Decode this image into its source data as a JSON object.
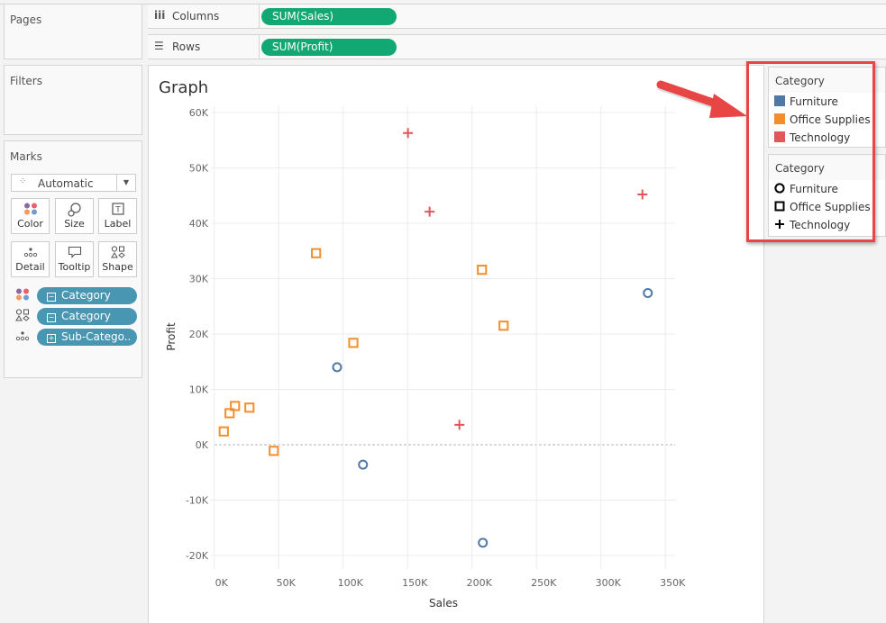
{
  "panels": {
    "pages_label": "Pages",
    "filters_label": "Filters",
    "marks_label": "Marks"
  },
  "shelves": {
    "columns": {
      "label": "Columns",
      "icon": "columns-icon",
      "pill": "SUM(Sales)"
    },
    "rows": {
      "label": "Rows",
      "icon": "rows-icon",
      "pill": "SUM(Profit)"
    }
  },
  "marks": {
    "mark_type": "Automatic",
    "buttons": [
      {
        "label": "Color",
        "icon": "color-icon"
      },
      {
        "label": "Size",
        "icon": "size-icon"
      },
      {
        "label": "Label",
        "icon": "label-icon"
      },
      {
        "label": "Detail",
        "icon": "detail-icon"
      },
      {
        "label": "Tooltip",
        "icon": "tooltip-icon"
      },
      {
        "label": "Shape",
        "icon": "shape-icon"
      }
    ],
    "fields": [
      {
        "role": "color",
        "label": "Category",
        "toggle": "−"
      },
      {
        "role": "shape",
        "label": "Category",
        "toggle": "−"
      },
      {
        "role": "detail",
        "label": "Sub-Catego..",
        "toggle": "+"
      }
    ]
  },
  "legends": {
    "color": {
      "title": "Category",
      "items": [
        {
          "label": "Furniture",
          "color": "#4e79a7"
        },
        {
          "label": "Office Supplies",
          "color": "#f28e2b"
        },
        {
          "label": "Technology",
          "color": "#e15759"
        }
      ]
    },
    "shape": {
      "title": "Category",
      "items": [
        {
          "label": "Furniture",
          "shape": "circle"
        },
        {
          "label": "Office Supplies",
          "shape": "square"
        },
        {
          "label": "Technology",
          "shape": "plus"
        }
      ]
    }
  },
  "colors": {
    "furniture": "#4e79a7",
    "office_supplies": "#f28e2b",
    "technology": "#e15759",
    "pill_green": "#12a874",
    "pill_blue": "#4996b2",
    "highlight": "#e84545"
  },
  "chart_data": {
    "type": "scatter",
    "title": "Graph",
    "xlabel": "Sales",
    "ylabel": "Profit",
    "xlim": [
      0,
      355
    ],
    "ylim": [
      -22,
      61
    ],
    "units": "K",
    "x_ticks": [
      "0K",
      "50K",
      "100K",
      "150K",
      "200K",
      "250K",
      "300K",
      "350K"
    ],
    "x_tick_values": [
      0,
      50,
      100,
      150,
      200,
      250,
      300,
      350
    ],
    "y_ticks": [
      "60K",
      "50K",
      "40K",
      "30K",
      "20K",
      "10K",
      "0K",
      "-10K",
      "-20K"
    ],
    "y_tick_values": [
      60,
      50,
      40,
      30,
      20,
      10,
      0,
      -10,
      -20
    ],
    "grid": true,
    "zero_line": "dotted",
    "legend": "right",
    "series": [
      {
        "name": "Furniture",
        "shape": "circle",
        "color": "#4e79a7",
        "points": [
          [
            95.3,
            14.0
          ],
          [
            115.4,
            -3.6
          ],
          [
            208.4,
            -17.7
          ],
          [
            336.4,
            27.4
          ]
        ]
      },
      {
        "name": "Office Supplies",
        "shape": "square",
        "color": "#f28e2b",
        "points": [
          [
            7.4,
            2.4
          ],
          [
            11.9,
            5.7
          ],
          [
            16.1,
            7.0
          ],
          [
            27.3,
            6.7
          ],
          [
            46.2,
            -1.1
          ],
          [
            79.0,
            34.6
          ],
          [
            107.9,
            18.4
          ],
          [
            207.7,
            31.6
          ],
          [
            224.5,
            21.5
          ]
        ]
      },
      {
        "name": "Technology",
        "shape": "plus",
        "color": "#e15759",
        "points": [
          [
            150.3,
            56.3
          ],
          [
            167.1,
            42.1
          ],
          [
            190.2,
            3.6
          ],
          [
            332.2,
            45.2
          ]
        ]
      }
    ]
  }
}
